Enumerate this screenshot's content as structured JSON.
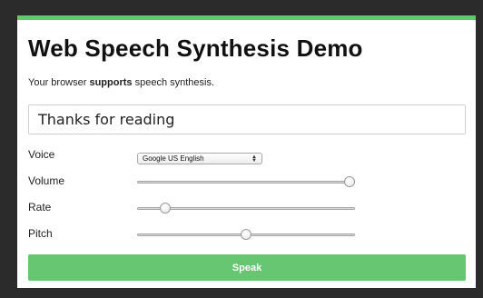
{
  "title": "Web Speech Synthesis Demo",
  "support": {
    "prefix": "Your browser",
    "emphasis": "supports",
    "suffix": "speech synthesis."
  },
  "text_input": {
    "value": "Thanks for reading"
  },
  "voice": {
    "label": "Voice",
    "selected": "Google US English"
  },
  "volume": {
    "label": "Volume",
    "level": 1.0
  },
  "rate": {
    "label": "Rate",
    "level": 0.11
  },
  "pitch": {
    "label": "Pitch",
    "level": 0.5
  },
  "speak_button": {
    "label": "Speak"
  },
  "colors": {
    "accent": "#5cc96a",
    "button": "#66c672",
    "window_background": "#2b2b2b"
  }
}
